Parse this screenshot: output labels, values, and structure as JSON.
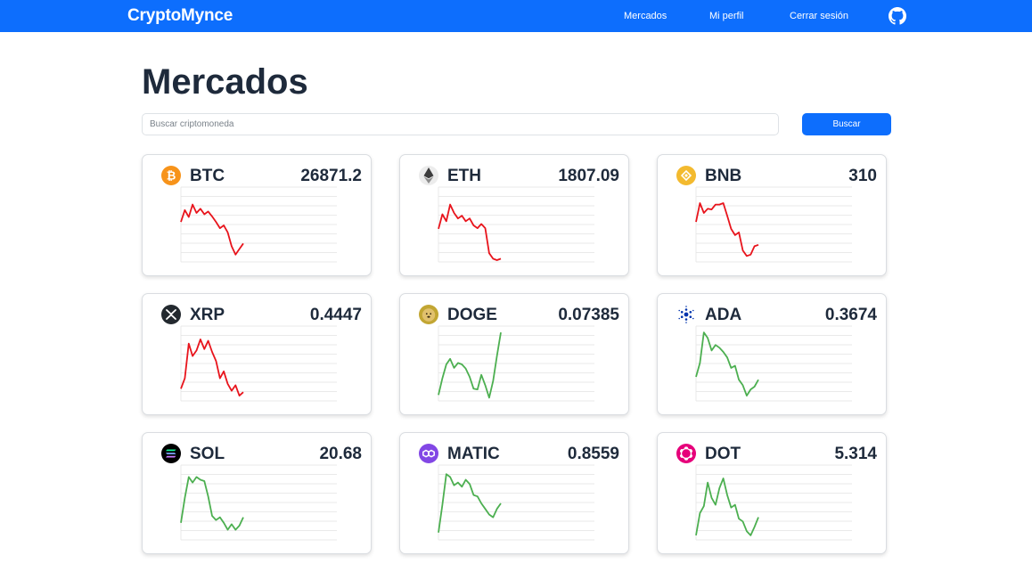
{
  "navbar": {
    "brand": "CryptoMynce",
    "links": {
      "markets": "Mercados",
      "profile": "Mi perfil",
      "logout": "Cerrar sesión"
    },
    "github_icon": "github-icon",
    "background": "#0d6efd"
  },
  "page": {
    "title": "Mercados"
  },
  "search": {
    "placeholder": "Buscar criptomoneda",
    "value": "",
    "button_label": "Buscar"
  },
  "colors": {
    "down": "#e8141c",
    "up": "#4caf50",
    "accent": "#0d6efd"
  },
  "coins": [
    {
      "symbol": "BTC",
      "price": "26871.2",
      "icon": "bitcoin-icon",
      "icon_color": "#f7931a",
      "trend": "down",
      "chart": [
        0.55,
        0.72,
        0.62,
        0.8,
        0.68,
        0.74,
        0.66,
        0.7,
        0.63,
        0.55,
        0.46,
        0.5,
        0.4,
        0.2,
        0.08,
        0.16,
        0.24
      ]
    },
    {
      "symbol": "ETH",
      "price": "1807.09",
      "icon": "ethereum-icon",
      "icon_color": "#3c3c3d",
      "trend": "down",
      "chart": [
        0.45,
        0.66,
        0.56,
        0.8,
        0.68,
        0.6,
        0.64,
        0.56,
        0.6,
        0.5,
        0.46,
        0.52,
        0.46,
        0.1,
        0.02,
        0.0,
        0.02
      ]
    },
    {
      "symbol": "BNB",
      "price": "310",
      "icon": "bnb-icon",
      "icon_color": "#f3ba2f",
      "trend": "down",
      "chart": [
        0.55,
        0.82,
        0.68,
        0.74,
        0.73,
        0.8,
        0.8,
        0.82,
        0.64,
        0.45,
        0.36,
        0.4,
        0.14,
        0.06,
        0.08,
        0.2,
        0.22
      ]
    },
    {
      "symbol": "XRP",
      "price": "0.4447",
      "icon": "xrp-icon",
      "icon_color": "#23292f",
      "trend": "down",
      "chart": [
        0.15,
        0.3,
        0.8,
        0.62,
        0.7,
        0.86,
        0.72,
        0.84,
        0.68,
        0.55,
        0.3,
        0.4,
        0.22,
        0.12,
        0.2,
        0.05,
        0.1
      ]
    },
    {
      "symbol": "DOGE",
      "price": "0.07385",
      "icon": "dogecoin-icon",
      "icon_color": "#c2a633",
      "trend": "up",
      "chart": [
        0.06,
        0.3,
        0.5,
        0.58,
        0.45,
        0.52,
        0.5,
        0.44,
        0.32,
        0.15,
        0.14,
        0.35,
        0.2,
        0.02,
        0.26,
        0.62,
        0.96
      ]
    },
    {
      "symbol": "ADA",
      "price": "0.3674",
      "icon": "cardano-icon",
      "icon_color": "#0033ad",
      "trend": "up",
      "chart": [
        0.32,
        0.52,
        0.96,
        0.88,
        0.7,
        0.78,
        0.74,
        0.68,
        0.6,
        0.45,
        0.48,
        0.28,
        0.2,
        0.05,
        0.14,
        0.18,
        0.28
      ]
    },
    {
      "symbol": "SOL",
      "price": "20.68",
      "icon": "solana-icon",
      "icon_color": "#000000",
      "trend": "up",
      "chart": [
        0.22,
        0.58,
        0.88,
        0.8,
        0.88,
        0.84,
        0.82,
        0.6,
        0.32,
        0.26,
        0.3,
        0.22,
        0.12,
        0.2,
        0.12,
        0.18,
        0.3
      ]
    },
    {
      "symbol": "MATIC",
      "price": "0.8559",
      "icon": "polygon-icon",
      "icon_color": "#8247e5",
      "trend": "up",
      "chart": [
        0.08,
        0.48,
        0.92,
        0.88,
        0.76,
        0.8,
        0.74,
        0.84,
        0.78,
        0.62,
        0.6,
        0.5,
        0.42,
        0.34,
        0.3,
        0.42,
        0.5
      ]
    },
    {
      "symbol": "DOT",
      "price": "5.314",
      "icon": "polkadot-icon",
      "icon_color": "#e6007a",
      "trend": "up",
      "chart": [
        0.04,
        0.36,
        0.46,
        0.8,
        0.58,
        0.48,
        0.72,
        0.86,
        0.62,
        0.44,
        0.48,
        0.28,
        0.24,
        0.1,
        0.04,
        0.16,
        0.3
      ]
    }
  ]
}
